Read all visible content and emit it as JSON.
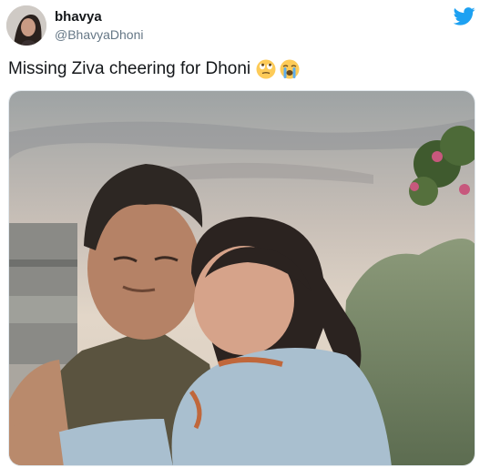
{
  "tweet": {
    "display_name": "bhavya",
    "handle": "@BhavyaDhoni",
    "text": "Missing Ziva cheering for Dhoni",
    "emojis": [
      "eye-roll-emoji",
      "loudly-crying-emoji"
    ]
  },
  "icons": {
    "brand": "twitter-bird-icon"
  },
  "colors": {
    "twitter_blue": "#1da1f2",
    "name_text": "#14171a",
    "handle_text": "#657786"
  }
}
